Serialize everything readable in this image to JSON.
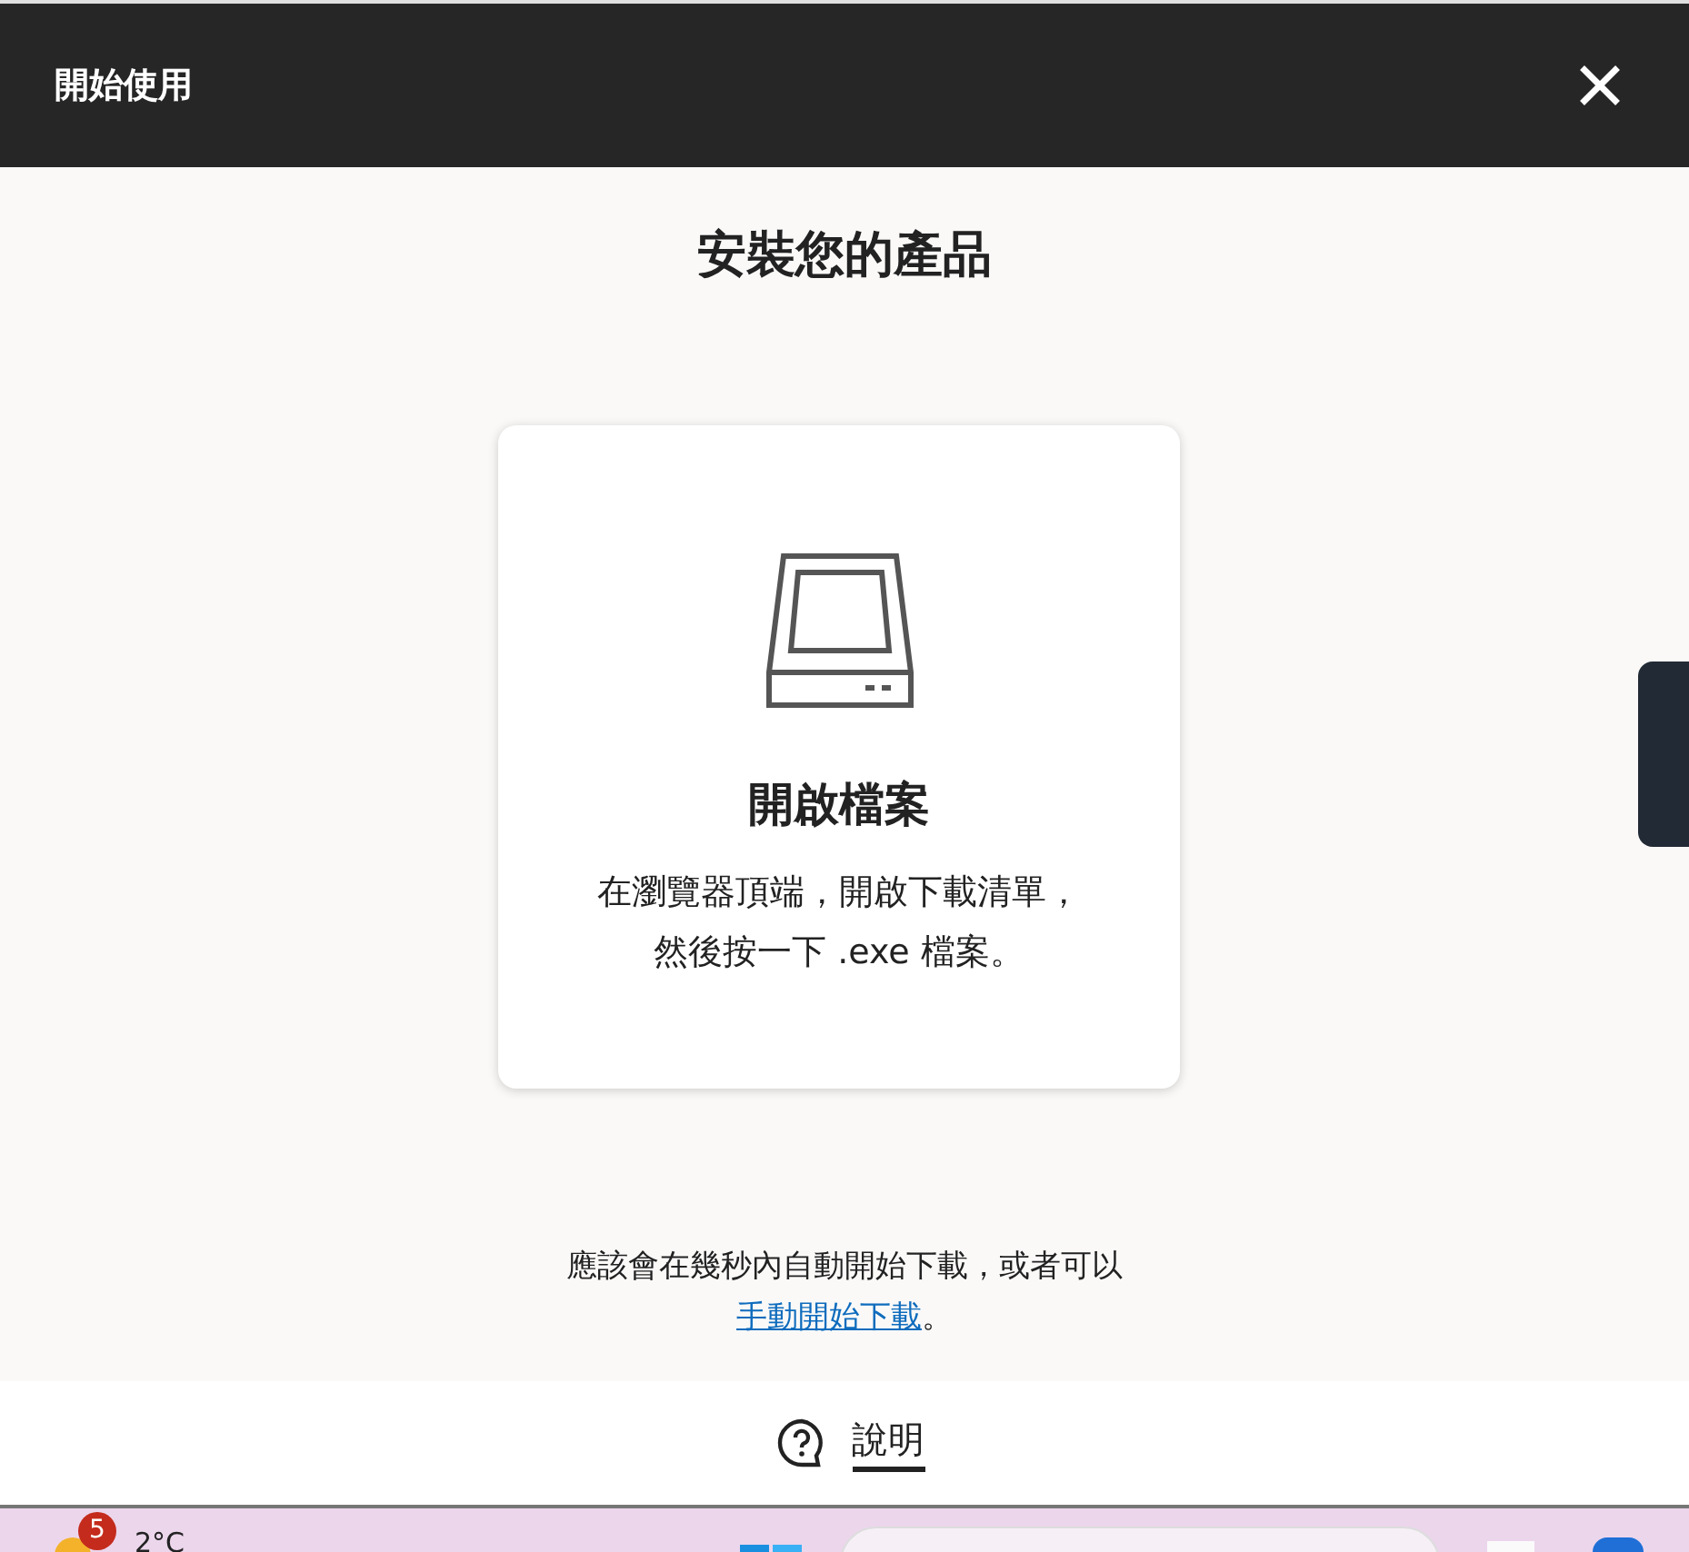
{
  "header": {
    "title": "開始使用"
  },
  "heading": "安裝您的產品",
  "card": {
    "title": "開啟檔案",
    "lines": [
      "在瀏覽器頂端，開啟下載清單，",
      "然後按一下 .exe 檔案。"
    ]
  },
  "note": {
    "text": "應該會在幾秒內自動開始下載，或者可以",
    "link": "手動開始下載",
    "end": "。"
  },
  "help": {
    "label": "說明"
  },
  "taskbar": {
    "badge": "5",
    "temperature": "2°C"
  }
}
